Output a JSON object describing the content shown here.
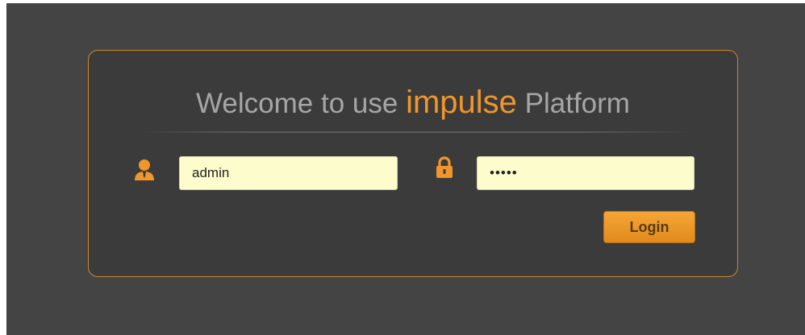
{
  "login": {
    "title_prefix": "Welcome to use ",
    "title_brand": "impulse",
    "title_suffix": " Platform",
    "username_value": "admin",
    "password_value": "•••••",
    "login_label": "Login"
  },
  "icons": {
    "username": "user-icon",
    "password": "lock-icon"
  },
  "colors": {
    "background": "#444444",
    "panel": "#3b3b3b",
    "accent": "#f0962a",
    "panel_border": "#c8882b",
    "input_bg": "#fcfccc",
    "title_gray": "#a6a6a6"
  }
}
